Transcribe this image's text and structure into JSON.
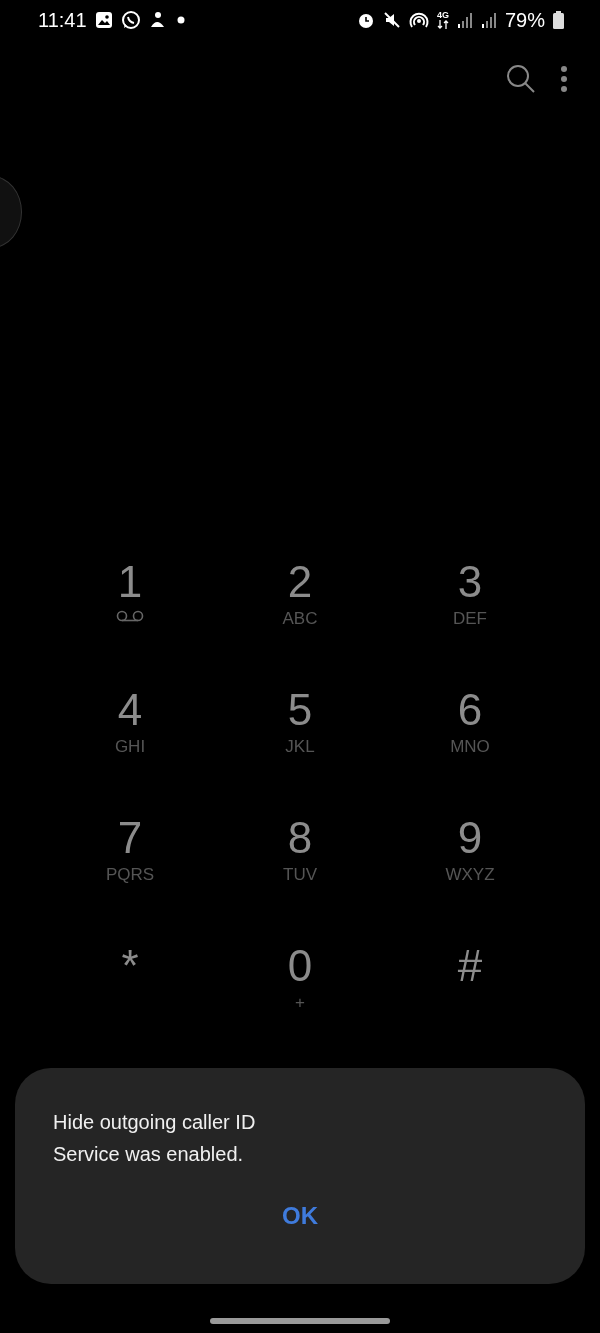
{
  "status_bar": {
    "time": "11:41",
    "network": "4G",
    "battery": "79%"
  },
  "keypad": [
    {
      "digit": "1",
      "kind": "voicemail"
    },
    {
      "digit": "2",
      "kind": "letters",
      "sub": "ABC"
    },
    {
      "digit": "3",
      "kind": "letters",
      "sub": "DEF"
    },
    {
      "digit": "4",
      "kind": "letters",
      "sub": "GHI"
    },
    {
      "digit": "5",
      "kind": "letters",
      "sub": "JKL"
    },
    {
      "digit": "6",
      "kind": "letters",
      "sub": "MNO"
    },
    {
      "digit": "7",
      "kind": "letters",
      "sub": "PQRS"
    },
    {
      "digit": "8",
      "kind": "letters",
      "sub": "TUV"
    },
    {
      "digit": "9",
      "kind": "letters",
      "sub": "WXYZ"
    },
    {
      "digit": "*",
      "kind": "symbol"
    },
    {
      "digit": "0",
      "kind": "letters",
      "sub": "+"
    },
    {
      "digit": "#",
      "kind": "symbol"
    }
  ],
  "dialog": {
    "title": "Hide outgoing caller ID",
    "message": "Service was enabled.",
    "button": "OK"
  }
}
